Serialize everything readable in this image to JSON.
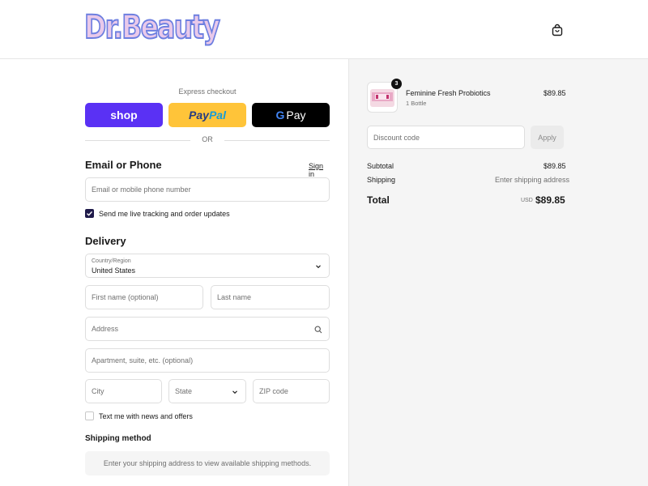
{
  "brand": {
    "logo_text": "Dr.Beauty"
  },
  "header": {
    "cart_icon": "shopping-bag-icon"
  },
  "express": {
    "label": "Express checkout",
    "shop_label": "shop",
    "paypal_part1": "Pay",
    "paypal_part2": "Pal",
    "gpay_g": "G",
    "gpay_label": "Pay",
    "or_label": "OR"
  },
  "contact": {
    "heading": "Email or Phone",
    "signin_link": "Sign in",
    "email_placeholder": "Email or mobile phone number",
    "tracking_label": "Send me live tracking and order updates",
    "tracking_checked": true
  },
  "delivery": {
    "heading": "Delivery",
    "country_label": "Country/Region",
    "country_value": "United States",
    "first_name_placeholder": "First name (optional)",
    "last_name_placeholder": "Last name",
    "address_placeholder": "Address",
    "apartment_placeholder": "Apartment, suite, etc. (optional)",
    "city_placeholder": "City",
    "state_placeholder": "State",
    "zip_placeholder": "ZIP code",
    "news_label": "Text me with news and offers",
    "news_checked": false
  },
  "shipping_method": {
    "heading": "Shipping method",
    "message": "Enter your shipping address to view available shipping methods."
  },
  "summary": {
    "item": {
      "name": "Feminine Fresh Probiotics",
      "variant": "1 Bottle",
      "price": "$89.85",
      "quantity": "3"
    },
    "discount_placeholder": "Discount code",
    "apply_label": "Apply",
    "subtotal_label": "Subtotal",
    "subtotal_value": "$89.85",
    "shipping_label": "Shipping",
    "shipping_value": "Enter shipping address",
    "total_label": "Total",
    "currency": "USD",
    "total_value": "$89.85"
  },
  "colors": {
    "shop_purple": "#5a31f4",
    "paypal_yellow": "#ffc439",
    "gpay_black": "#000000",
    "checkbox_navy": "#1f1a4a",
    "summary_bg": "#f5f5f5"
  }
}
